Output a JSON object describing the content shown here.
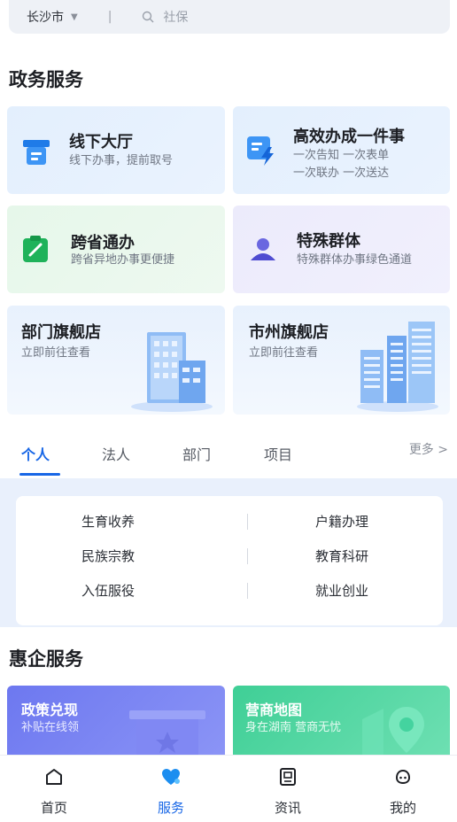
{
  "search": {
    "city": "长沙市",
    "placeholder": "社保"
  },
  "gov": {
    "title": "政务服务",
    "cards": [
      {
        "title": "线下大厅",
        "sub": "线下办事，提前取号"
      },
      {
        "title": "高效办成一件事",
        "sub1": "一次告知  一次表单",
        "sub2": "一次联办  一次送达"
      },
      {
        "title": "跨省通办",
        "sub": "跨省异地办事更便捷"
      },
      {
        "title": "特殊群体",
        "sub": "特殊群体办事绿色通道"
      },
      {
        "title": "部门旗舰店",
        "sub": "立即前往查看"
      },
      {
        "title": "市州旗舰店",
        "sub": "立即前往查看"
      }
    ]
  },
  "tabs": {
    "items": [
      "个人",
      "法人",
      "部门",
      "项目"
    ],
    "more": "更多 >"
  },
  "grid": {
    "items": [
      "生育收养",
      "户籍办理",
      "民族宗教",
      "教育科研",
      "入伍服役",
      "就业创业"
    ]
  },
  "biz": {
    "title": "惠企服务",
    "cards": [
      {
        "title": "政策兑现",
        "sub": "补贴在线领"
      },
      {
        "title": "营商地图",
        "sub": "身在湖南 营商无忧"
      }
    ]
  },
  "nav": {
    "items": [
      "首页",
      "服务",
      "资讯",
      "我的"
    ]
  },
  "colors": {
    "accent": "#1766e6"
  }
}
